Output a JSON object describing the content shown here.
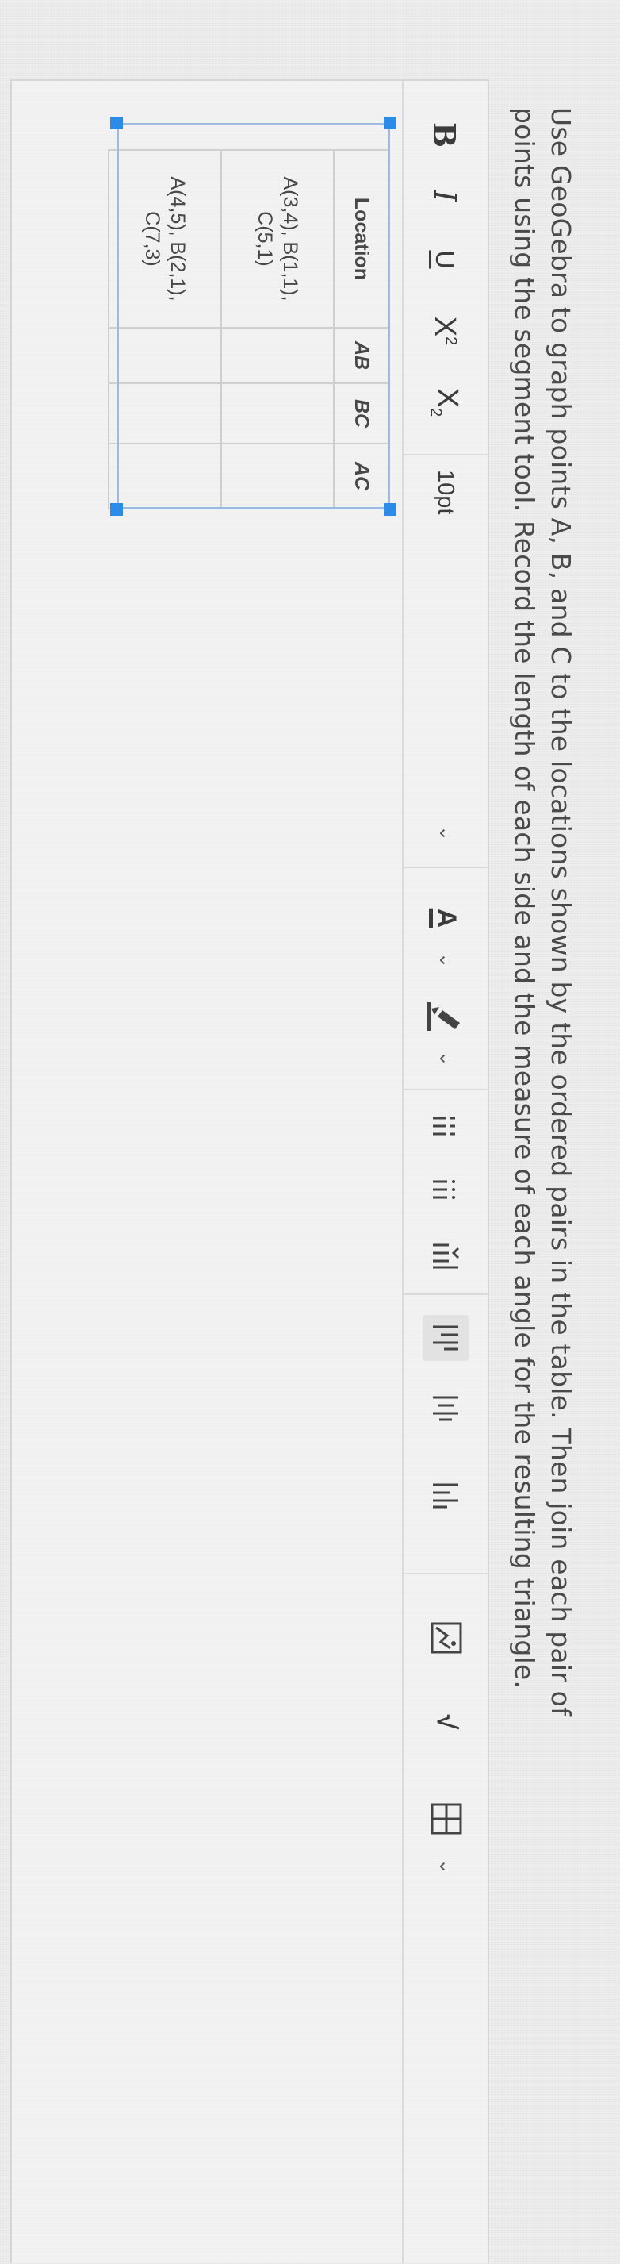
{
  "instructions": {
    "line1": "Use GeoGebra to graph points A, B, and C to the locations shown by the ordered pairs in the table. Then join each pair of",
    "line2": "points using the segment tool. Record the length of each side and the measure of each angle for the resulting triangle."
  },
  "toolbar": {
    "bold": "B",
    "italic": "I",
    "underline": "U",
    "superscript": "X",
    "superscript_mark": "2",
    "subscript": "X",
    "subscript_mark": "2",
    "font_size": "10pt",
    "font_color": "A",
    "math": "√",
    "icons": [
      "bold-icon",
      "italic-icon",
      "underline-icon",
      "superscript-icon",
      "subscript-icon",
      "font-color-icon",
      "highlight-icon",
      "bulleted-list-icon",
      "numbered-list-icon",
      "indent-icon",
      "align-left-icon",
      "align-center-icon",
      "align-right-icon",
      "image-icon",
      "math-icon",
      "table-icon"
    ]
  },
  "table": {
    "headers": [
      "Location",
      "AB",
      "BC",
      "AC"
    ],
    "rows": [
      {
        "location_line1": "A(3,4), B(1,1),",
        "location_line2": "C(5,1)",
        "ab": "",
        "bc": "",
        "ac": ""
      },
      {
        "location_line1": "A(4,5), B(2,1),",
        "location_line2": "C(7,3)",
        "ab": "",
        "bc": "",
        "ac": ""
      }
    ]
  },
  "colors": {
    "selection_handle": "#2b8be6",
    "selection_border": "#9dbbe0",
    "text": "#4a4a4a"
  }
}
